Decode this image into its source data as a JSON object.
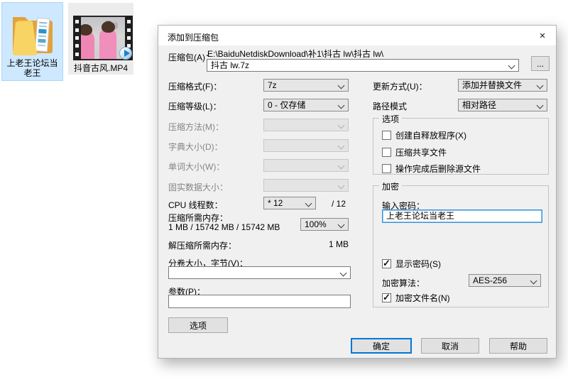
{
  "desktop": {
    "folder": {
      "label": "上老王论坛当老王"
    },
    "video": {
      "label": "抖音古风.MP4"
    }
  },
  "icons": {
    "check": "✓",
    "close": "×"
  },
  "dialog": {
    "title": "添加到压缩包",
    "archive_label": "压缩包(A)：",
    "archive_path": "E:\\BaiduNetdiskDownload\\补1\\抖古 lw\\抖古 lw\\",
    "archive_name": "抖古 lw.7z",
    "browse_label": "...",
    "fields": {
      "format_label": "压缩格式(F)：",
      "format_value": "7z",
      "level_label": "压缩等级(L)：",
      "level_value": "0 - 仅存储",
      "method_label": "压缩方法(M)：",
      "dict_label": "字典大小(D)：",
      "word_label": "单词大小(W)：",
      "solid_label": "固实数据大小：",
      "cpu_label": "CPU 线程数：",
      "cpu_value": "* 12",
      "cpu_total": "/ 12",
      "mem_label": "压缩所需内存：",
      "mem_detail": "1 MB / 15742 MB / 15742 MB",
      "mem_percent": "100%",
      "unmem_label": "解压缩所需内存：",
      "unmem_value": "1 MB",
      "volume_label": "分卷大小，字节(V)：",
      "params_label": "参数(P)：",
      "options_button": "选项"
    },
    "right": {
      "update_label": "更新方式(U)：",
      "update_value": "添加并替换文件",
      "pathmode_label": "路径模式",
      "pathmode_value": "相对路径",
      "options_title": "选项",
      "options": [
        {
          "label": "创建自释放程序(X)"
        },
        {
          "label": "压缩共享文件"
        },
        {
          "label": "操作完成后删除源文件"
        }
      ],
      "enc_title": "加密",
      "enc_password_label": "输入密码：",
      "enc_password_value": "上老王论坛当老王",
      "enc_show_label": "显示密码(S)",
      "enc_method_label": "加密算法：",
      "enc_method_value": "AES-256",
      "enc_names_label": "加密文件名(N)"
    },
    "buttons": {
      "ok": "确定",
      "cancel": "取消",
      "help": "帮助"
    }
  }
}
